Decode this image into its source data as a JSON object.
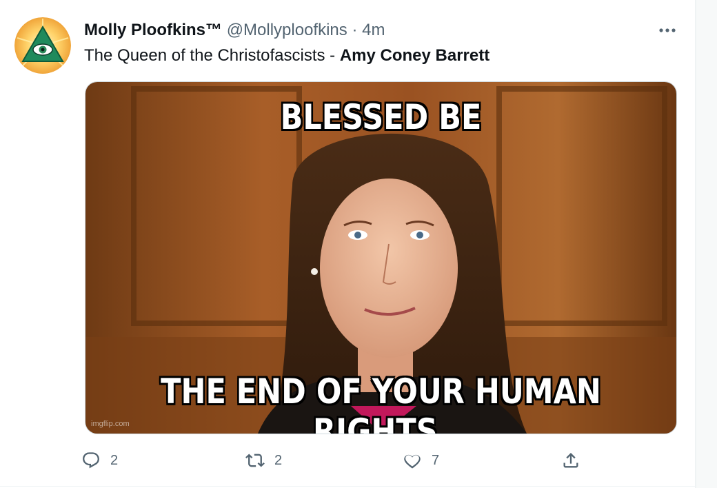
{
  "tweet": {
    "display_name": "Molly Ploofkins™",
    "handle": "@Mollyploofkins",
    "separator": "·",
    "time": "4m",
    "text_plain": "The Queen of the Christofascists - ",
    "text_bold": "Amy Coney Barrett",
    "more_label": "···"
  },
  "media": {
    "top_caption": "BLESSED BE",
    "bottom_caption": "THE END OF YOUR HUMAN RIGHTS.",
    "watermark": "imgflip.com"
  },
  "actions": {
    "reply_count": "2",
    "retweet_count": "2",
    "like_count": "7"
  },
  "icons": {
    "reply": "reply-icon",
    "retweet": "retweet-icon",
    "like": "heart-icon",
    "share": "share-icon",
    "more": "more-horizontal-icon"
  },
  "colors": {
    "text": "#0f1419",
    "secondary": "#536471",
    "border": "#cfd9de"
  }
}
